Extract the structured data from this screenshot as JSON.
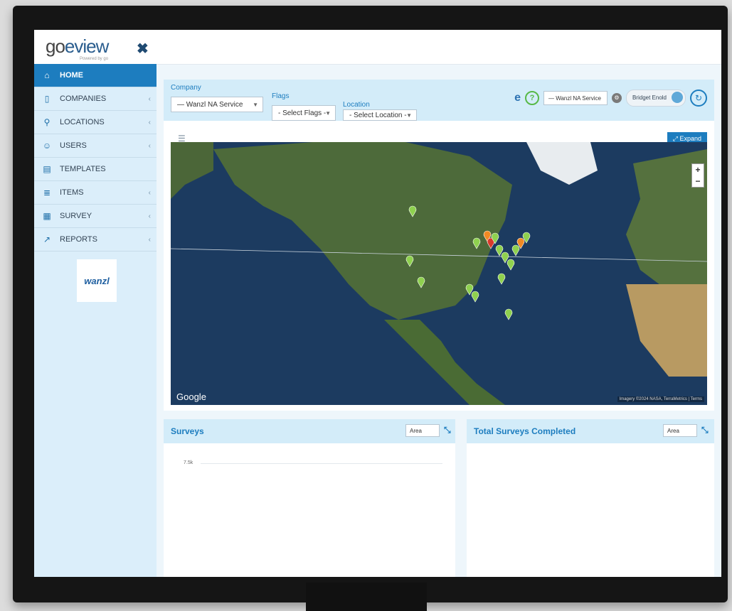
{
  "app": {
    "logo_text_go": "go",
    "logo_text_rest": "eview",
    "logo_subtitle": "Powered by go"
  },
  "sidebar": {
    "items": [
      {
        "label": "HOME",
        "icon": "home-icon",
        "glyph": "⌂",
        "active": true,
        "chevron": false
      },
      {
        "label": "COMPANIES",
        "icon": "building-icon",
        "glyph": "▯",
        "active": false,
        "chevron": true
      },
      {
        "label": "LOCATIONS",
        "icon": "map-pin-icon",
        "glyph": "⚲",
        "active": false,
        "chevron": true
      },
      {
        "label": "USERS",
        "icon": "users-icon",
        "glyph": "☺",
        "active": false,
        "chevron": true
      },
      {
        "label": "TEMPLATES",
        "icon": "template-icon",
        "glyph": "▤",
        "active": false,
        "chevron": false
      },
      {
        "label": "ITEMS",
        "icon": "list-icon",
        "glyph": "≣",
        "active": false,
        "chevron": true
      },
      {
        "label": "SURVEY",
        "icon": "survey-icon",
        "glyph": "▦",
        "active": false,
        "chevron": true
      },
      {
        "label": "REPORTS",
        "icon": "chart-icon",
        "glyph": "↗",
        "active": false,
        "chevron": true
      }
    ],
    "brand_logo": "wanzl"
  },
  "filters": {
    "company_label": "Company",
    "company_value": "— Wanzl NA Service",
    "flags_label": "Flags",
    "flags_value": "- Select Flags -",
    "location_label": "Location",
    "location_value": "- Select Location -"
  },
  "header": {
    "company_select_value": "— Wanzl NA Service",
    "user_name": "Bridget Enold"
  },
  "map": {
    "expand_label": "⤢ Expand",
    "zoom_in": "+",
    "zoom_out": "−",
    "google_label": "Google",
    "attribution": "Imagery ©2024 NASA, TerraMetrics | Terms",
    "colors": {
      "ocean": "#1c3b60",
      "land": "#4d6a3a",
      "marker_green": "#8fd14f",
      "marker_red": "#d93a2b",
      "marker_orange": "#f08a24"
    }
  },
  "surveys_panel": {
    "title": "Surveys",
    "chart_type_value": "Area",
    "y_tick": "7.5k"
  },
  "completed_panel": {
    "title": "Total Surveys Completed",
    "chart_type_value": "Area"
  },
  "colors": {
    "accent": "#1d7dbf",
    "sidebar_bg": "#dbeefa",
    "header_bg": "#d3ecf9"
  }
}
